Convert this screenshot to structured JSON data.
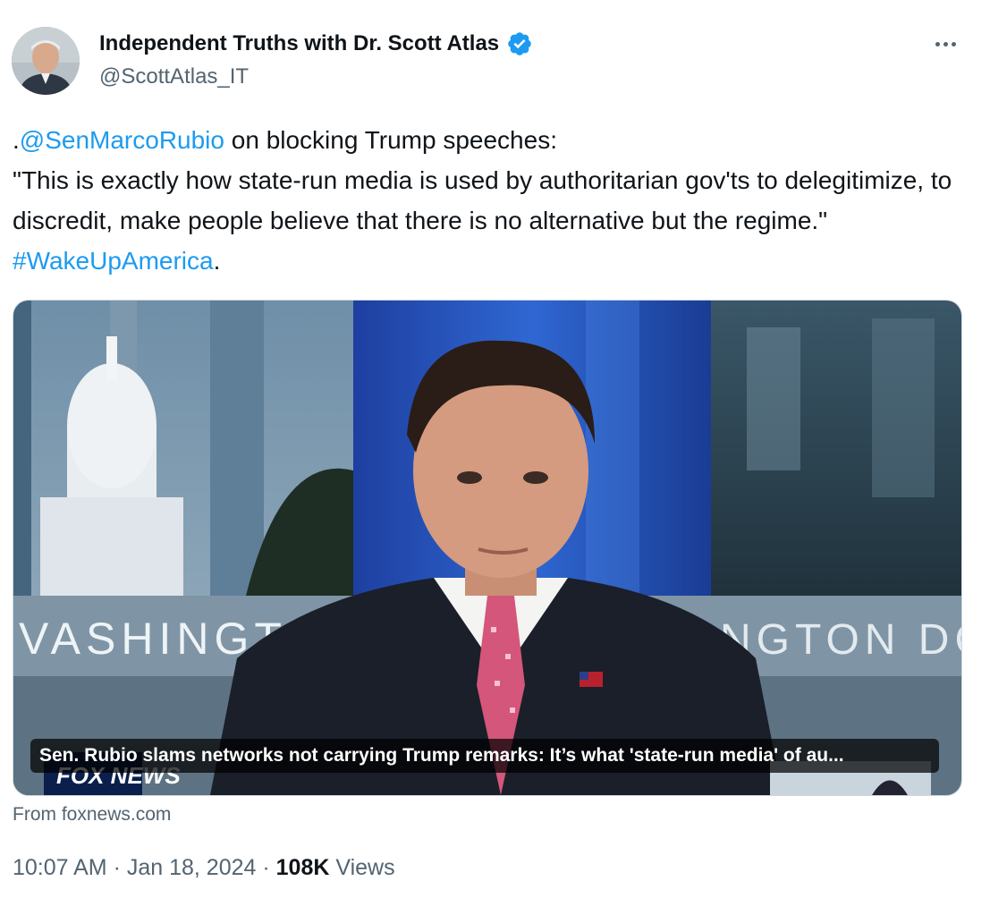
{
  "author": {
    "name": "Independent Truths with Dr. Scott Atlas",
    "handle": "@ScottAtlas_IT",
    "verified_color": "#1d9bf0"
  },
  "tweet": {
    "prefix": ".",
    "mention": "@SenMarcoRubio",
    "line1_rest": " on blocking Trump speeches:",
    "quote": "\"This is exactly how state-run media is used by authoritarian gov'ts to delegitimize, to discredit, make people believe that there is no alternative but the regime.\" ",
    "hashtag": "#WakeUpAmerica",
    "suffix": "."
  },
  "media": {
    "caption": "Sen. Rubio slams networks not carrying Trump remarks: It’s what 'state-run media' of au...",
    "backdrop_left": "VASHINGTO",
    "backdrop_right": "NGTON DC",
    "network_logo": "FOX NEWS"
  },
  "source": "From foxnews.com",
  "meta": {
    "time": "10:07 AM",
    "separator1": " · ",
    "date": "Jan 18, 2024",
    "separator2": " · ",
    "views_count": "108K",
    "views_label": " Views"
  },
  "icons": {
    "more": "more-horizontal-icon",
    "verified": "verified-badge-icon"
  }
}
